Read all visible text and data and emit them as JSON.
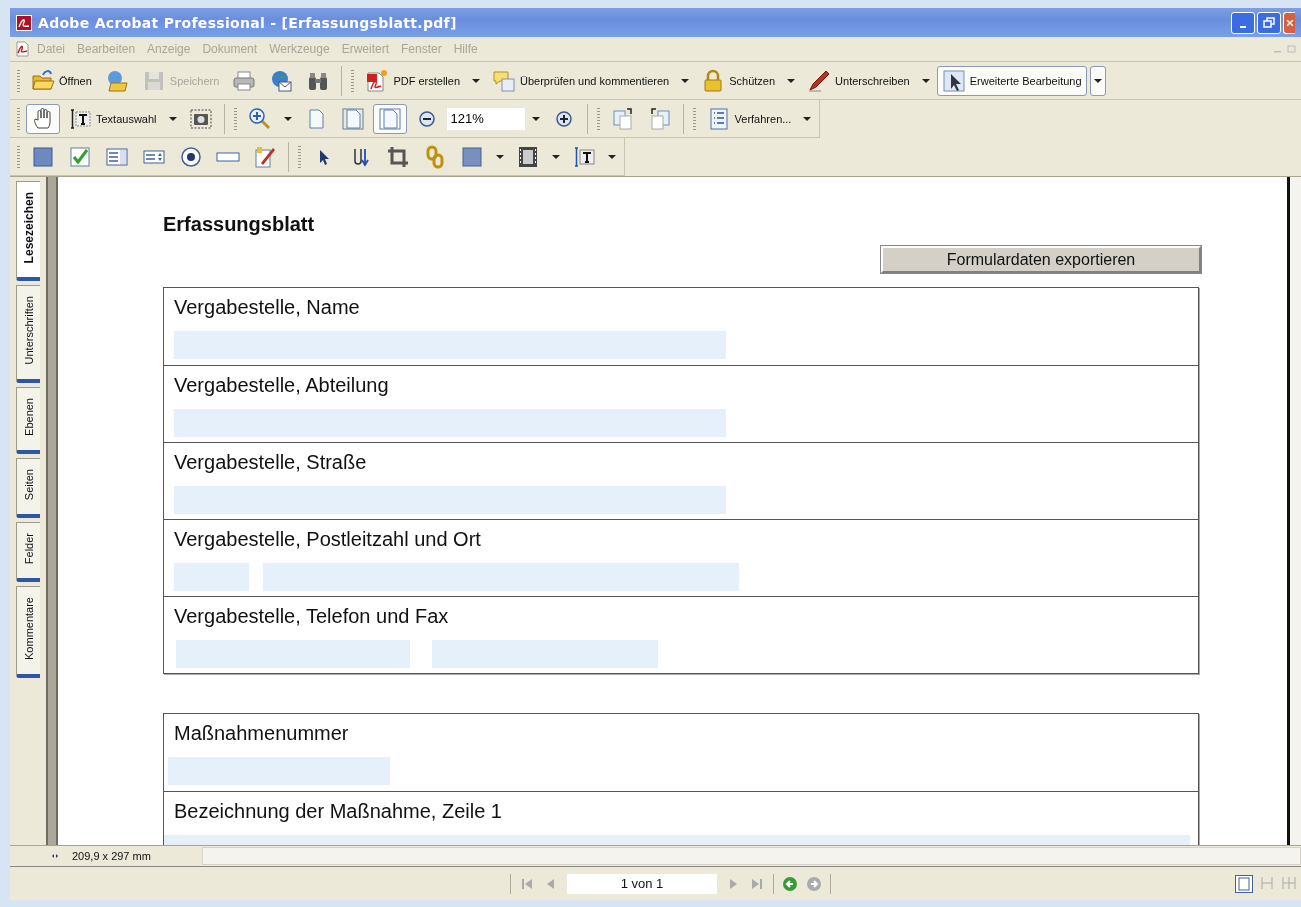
{
  "window": {
    "title": "Adobe Acrobat Professional - [Erfassungsblatt.pdf]"
  },
  "menu": [
    {
      "label": "Datei",
      "disabled": true
    },
    {
      "label": "Bearbeiten",
      "disabled": true
    },
    {
      "label": "Anzeige",
      "disabled": true
    },
    {
      "label": "Dokument",
      "disabled": true
    },
    {
      "label": "Werkzeuge",
      "disabled": true
    },
    {
      "label": "Erweitert",
      "disabled": true
    },
    {
      "label": "Fenster",
      "disabled": true
    },
    {
      "label": "Hilfe",
      "disabled": true
    }
  ],
  "toolbar_main": {
    "open": {
      "label": "Öffnen",
      "disabled": false
    },
    "save": {
      "label": "Speichern",
      "disabled": true
    },
    "create_pdf": {
      "label": "PDF erstellen"
    },
    "review": {
      "label": "Überprüfen und kommentieren"
    },
    "secure": {
      "label": "Schützen"
    },
    "sign": {
      "label": "Unterschreiben"
    },
    "advanced": {
      "label": "Erweiterte Bearbeitung",
      "selected": true
    }
  },
  "toolbar_view": {
    "hand": {
      "selected": true
    },
    "text_select": {
      "label": "Textauswahl",
      "selected": false
    },
    "page_views": [
      {
        "selected": false
      },
      {
        "selected": false
      },
      {
        "selected": true
      }
    ],
    "zoom": {
      "value": "121%"
    },
    "procedures": {
      "label": "Verfahren..."
    }
  },
  "sidebar_tabs": [
    {
      "label": "Lesezeichen",
      "selected": true
    },
    {
      "label": "Unterschriften",
      "selected": false
    },
    {
      "label": "Ebenen",
      "selected": false
    },
    {
      "label": "Seiten",
      "selected": false
    },
    {
      "label": "Felder",
      "selected": false
    },
    {
      "label": "Kommentare",
      "selected": false
    }
  ],
  "page": {
    "title": "Erfassungsblatt",
    "export_button": "Formulardaten exportieren",
    "sections": [
      {
        "rows": [
          {
            "label": "Vergabestelle, Name",
            "kind": "long"
          },
          {
            "label": "Vergabestelle, Abteilung",
            "kind": "long"
          },
          {
            "label": "Vergabestelle, Straße",
            "kind": "long"
          },
          {
            "label": "Vergabestelle, Postleitzahl und Ort",
            "kind": "short_long"
          },
          {
            "label": "Vergabestelle, Telefon und Fax",
            "kind": "pair"
          }
        ]
      },
      {
        "rows": [
          {
            "label": "Maßnahmenummer",
            "kind": "short"
          },
          {
            "label": "Bezeichnung der Maßnahme, Zeile 1",
            "kind": "full"
          }
        ]
      }
    ]
  },
  "status_bar": {
    "page_size": "209,9 x 297 mm",
    "page_field": "1 von 1"
  }
}
